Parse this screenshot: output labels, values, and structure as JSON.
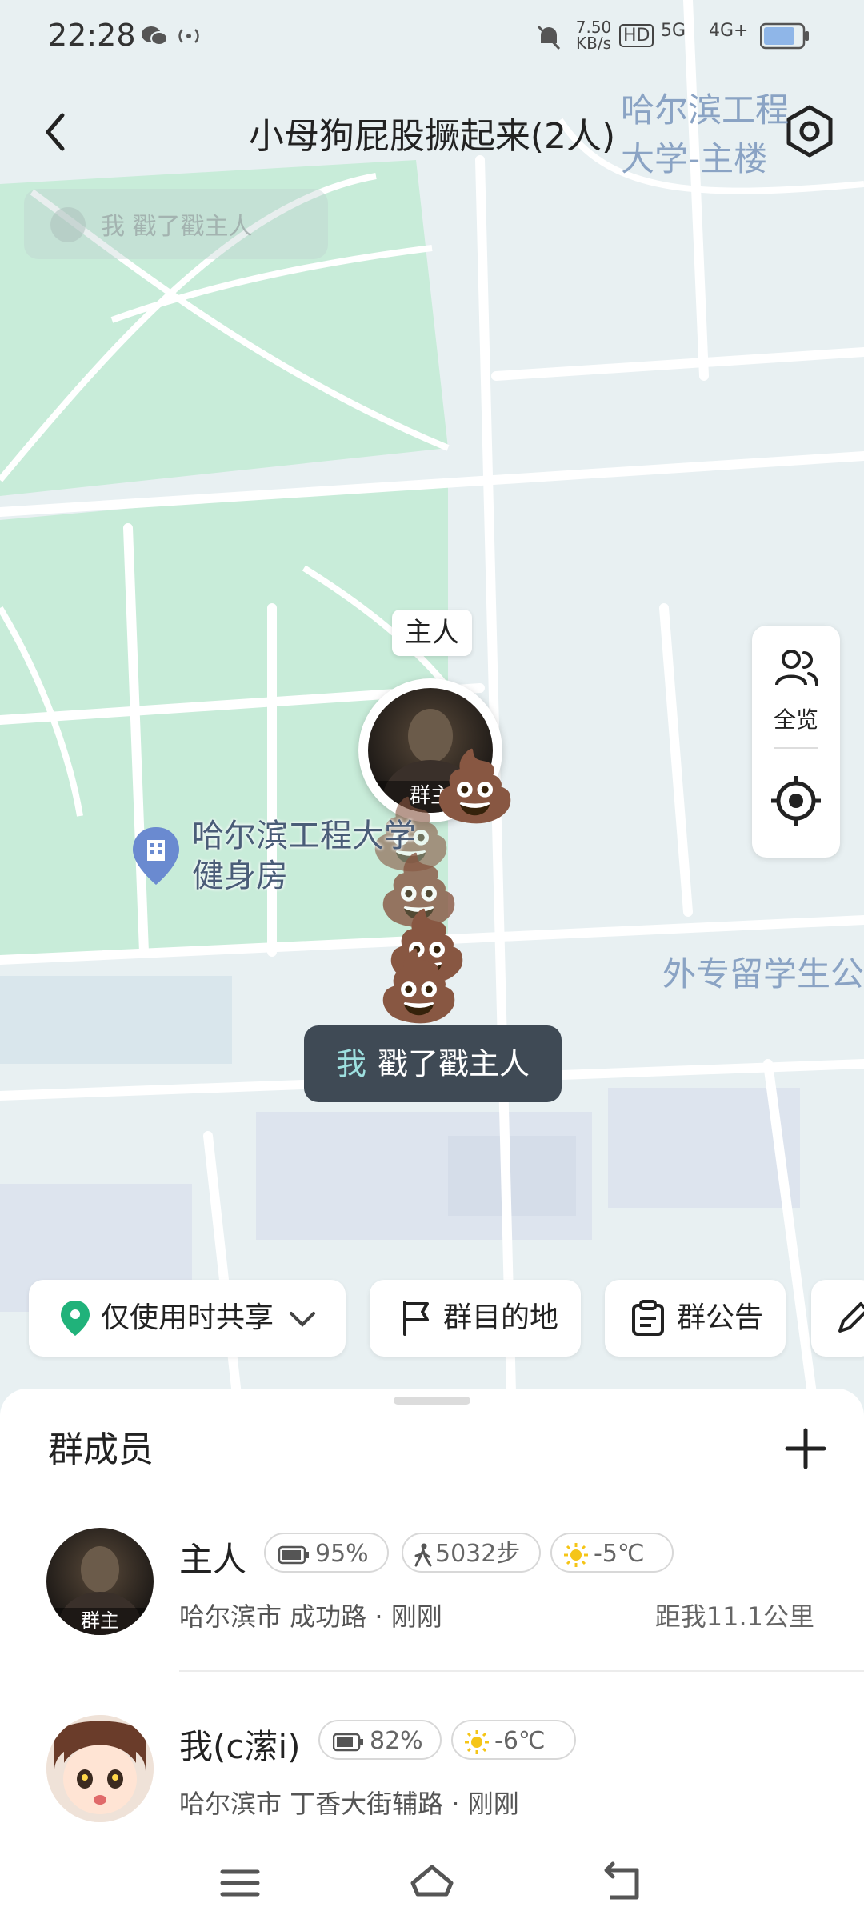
{
  "status_bar": {
    "time": "22:28",
    "net_speed": "7.50 KB/s",
    "hd_badge": "HD",
    "signal1": "5G",
    "signal2": "4G+",
    "icons": [
      "wechat-icon",
      "hotspot-icon",
      "mute-icon",
      "battery-icon"
    ]
  },
  "header": {
    "title": "小母狗屁股撅起来(2人)",
    "back_icon": "chevron-left-icon",
    "settings_icon": "settings-icon"
  },
  "ghost_toast": {
    "text": "我 戳了戳主人"
  },
  "map": {
    "marker_name": "主人",
    "marker_tag": "群主",
    "poi_label_line1": "哈尔滨工程大学",
    "poi_label_line2": "健身房",
    "label_top_right_line1": "哈尔滨工程",
    "label_top_right_line2": "大学-主楼",
    "label_right": "外专留学生公",
    "poop_emoji": "💩",
    "colors": {
      "green": "#c8ecd9",
      "base": "#e8f0f2",
      "road": "#ffffff",
      "building": "#dfe6ee"
    }
  },
  "toast": {
    "me": "我",
    "text": "戳了戳主人"
  },
  "side_panel": {
    "overview_label": "全览",
    "locate_icon": "locate-icon"
  },
  "chips": {
    "share": "仅使用时共享",
    "destination": "群目的地",
    "notice": "群公告"
  },
  "sheet": {
    "title": "群成员",
    "members": [
      {
        "name": "主人",
        "tag": "群主",
        "battery": "95%",
        "steps": "5032步",
        "weather": "-5℃",
        "address": "哈尔滨市 成功路 · 刚刚",
        "distance": "距我11.1公里"
      },
      {
        "name": "我(c潆i)",
        "battery": "82%",
        "weather": "-6℃",
        "address": "哈尔滨市 丁香大街辅路 · 刚刚"
      }
    ]
  },
  "navbar": {
    "icons": [
      "menu-icon",
      "home-icon",
      "back-icon"
    ]
  }
}
